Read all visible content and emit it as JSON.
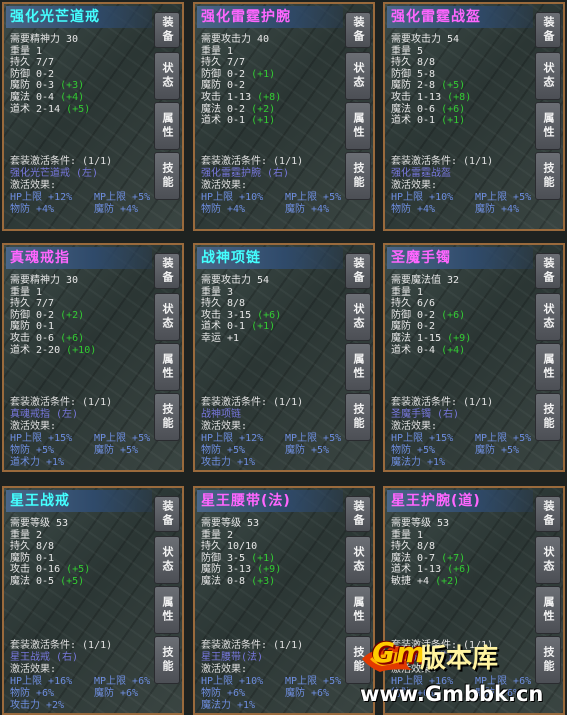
{
  "cards": [
    {
      "title": "强化光芒道戒",
      "title_color": "#44ffff",
      "stats": [
        {
          "text": "需要精神力 30",
          "bonus": ""
        },
        {
          "text": "重量 1",
          "bonus": ""
        },
        {
          "text": "持久 7/7",
          "bonus": ""
        },
        {
          "text": "防御 0-2",
          "bonus": ""
        },
        {
          "text": "魔防 0-3",
          "bonus": "(+3)"
        },
        {
          "text": "魔法 0-4",
          "bonus": "(+4)"
        },
        {
          "text": "道术 2-14",
          "bonus": "(+5)"
        }
      ],
      "set_label": "套装激活条件: (1/1)",
      "set_piece": "强化光芒道戒 (左)",
      "effect_label": "激活效果:",
      "effects": [
        "HP上限 +12%",
        "MP上限 +5%",
        "物防 +4%",
        "魔防 +4%"
      ]
    },
    {
      "title": "强化雷霆护腕",
      "title_color": "#ff66ff",
      "stats": [
        {
          "text": "需要攻击力 40",
          "bonus": ""
        },
        {
          "text": "重量 1",
          "bonus": ""
        },
        {
          "text": "持久 7/7",
          "bonus": ""
        },
        {
          "text": "防御 0-2",
          "bonus": "(+1)"
        },
        {
          "text": "魔防 0-2",
          "bonus": ""
        },
        {
          "text": "攻击 1-13",
          "bonus": "(+8)"
        },
        {
          "text": "魔法 0-2",
          "bonus": "(+2)"
        },
        {
          "text": "道术 0-1",
          "bonus": "(+1)"
        }
      ],
      "set_label": "套装激活条件: (1/1)",
      "set_piece": "强化雷霆护腕 (右)",
      "effect_label": "激活效果:",
      "effects": [
        "HP上限 +10%",
        "MP上限 +5%",
        "物防 +4%",
        "魔防 +4%"
      ]
    },
    {
      "title": "强化雷霆战盔",
      "title_color": "#ff66ff",
      "stats": [
        {
          "text": "需要攻击力 54",
          "bonus": ""
        },
        {
          "text": "重量 5",
          "bonus": ""
        },
        {
          "text": "持久 8/8",
          "bonus": ""
        },
        {
          "text": "防御 5-8",
          "bonus": ""
        },
        {
          "text": "魔防 2-8",
          "bonus": "(+5)"
        },
        {
          "text": "攻击 1-13",
          "bonus": "(+8)"
        },
        {
          "text": "魔法 0-6",
          "bonus": "(+6)"
        },
        {
          "text": "道术 0-1",
          "bonus": "(+1)"
        }
      ],
      "set_label": "套装激活条件: (1/1)",
      "set_piece": "强化雷霆战盔",
      "effect_label": "激活效果:",
      "effects": [
        "HP上限 +10%",
        "MP上限 +5%",
        "物防 +4%",
        "魔防 +4%"
      ]
    },
    {
      "title": "真魂戒指",
      "title_color": "#ff66ff",
      "stats": [
        {
          "text": "需要精神力 30",
          "bonus": ""
        },
        {
          "text": "重量 1",
          "bonus": ""
        },
        {
          "text": "持久 7/7",
          "bonus": ""
        },
        {
          "text": "防御 0-2",
          "bonus": "(+2)"
        },
        {
          "text": "魔防 0-1",
          "bonus": ""
        },
        {
          "text": "攻击 0-6",
          "bonus": "(+6)"
        },
        {
          "text": "道术 2-20",
          "bonus": "(+10)"
        }
      ],
      "set_label": "套装激活条件: (1/1)",
      "set_piece": "真魂戒指 (左)",
      "effect_label": "激活效果:",
      "effects": [
        "HP上限 +15%",
        "MP上限 +5%",
        "物防 +5%",
        "魔防 +5%",
        "道术力 +1%"
      ]
    },
    {
      "title": "战神项链",
      "title_color": "#44ffff",
      "stats": [
        {
          "text": "需要攻击力 54",
          "bonus": ""
        },
        {
          "text": "重量 3",
          "bonus": ""
        },
        {
          "text": "持久 8/8",
          "bonus": ""
        },
        {
          "text": "攻击 3-15",
          "bonus": "(+6)"
        },
        {
          "text": "道术 0-1",
          "bonus": "(+1)"
        },
        {
          "text": "幸运 +1",
          "bonus": ""
        }
      ],
      "set_label": "套装激活条件: (1/1)",
      "set_piece": "战神项链",
      "effect_label": "激活效果:",
      "effects": [
        "HP上限 +12%",
        "MP上限 +5%",
        "物防 +5%",
        "魔防 +5%",
        "攻击力 +1%"
      ]
    },
    {
      "title": "圣魔手镯",
      "title_color": "#ff66ff",
      "stats": [
        {
          "text": "需要魔法值 32",
          "bonus": ""
        },
        {
          "text": "重量 1",
          "bonus": ""
        },
        {
          "text": "持久 6/6",
          "bonus": ""
        },
        {
          "text": "防御 0-2",
          "bonus": "(+6)"
        },
        {
          "text": "魔防 0-2",
          "bonus": ""
        },
        {
          "text": "魔法 1-15",
          "bonus": "(+9)"
        },
        {
          "text": "道术 0-4",
          "bonus": "(+4)"
        }
      ],
      "set_label": "套装激活条件: (1/1)",
      "set_piece": "圣魔手镯 (右)",
      "effect_label": "激活效果:",
      "effects": [
        "HP上限 +15%",
        "MP上限 +5%",
        "物防 +5%",
        "魔防 +5%",
        "魔法力 +1%"
      ]
    },
    {
      "title": "星王战戒",
      "title_color": "#44ffff",
      "stats": [
        {
          "text": "需要等级 53",
          "bonus": ""
        },
        {
          "text": "重量 2",
          "bonus": ""
        },
        {
          "text": "持久 8/8",
          "bonus": ""
        },
        {
          "text": "魔防 0-1",
          "bonus": ""
        },
        {
          "text": "攻击 0-16",
          "bonus": "(+5)"
        },
        {
          "text": "魔法 0-5",
          "bonus": "(+5)"
        }
      ],
      "set_label": "套装激活条件: (1/1)",
      "set_piece": "星王战戒 (右)",
      "effect_label": "激活效果:",
      "effects": [
        "HP上限 +16%",
        "MP上限 +6%",
        "物防 +6%",
        "魔防 +6%",
        "攻击力 +2%"
      ]
    },
    {
      "title": "星王腰带(法)",
      "title_color": "#ff66ff",
      "stats": [
        {
          "text": "需要等级 53",
          "bonus": ""
        },
        {
          "text": "重量 2",
          "bonus": ""
        },
        {
          "text": "持久 10/10",
          "bonus": ""
        },
        {
          "text": "防御 3-5",
          "bonus": "(+1)"
        },
        {
          "text": "魔防 3-13",
          "bonus": "(+9)"
        },
        {
          "text": "魔法 0-8",
          "bonus": "(+3)"
        }
      ],
      "set_label": "套装激活条件: (1/1)",
      "set_piece": "星王腰带(法)",
      "effect_label": "激活效果:",
      "effects": [
        "HP上限 +10%",
        "MP上限 +5%",
        "物防 +6%",
        "魔防 +6%",
        "魔法力 +1%"
      ]
    },
    {
      "title": "星王护腕(道)",
      "title_color": "#ff66ff",
      "stats": [
        {
          "text": "需要等级 53",
          "bonus": ""
        },
        {
          "text": "重量 1",
          "bonus": ""
        },
        {
          "text": "持久 8/8",
          "bonus": ""
        },
        {
          "text": "魔法 0-7",
          "bonus": "(+7)"
        },
        {
          "text": "道术 1-13",
          "bonus": "(+6)"
        },
        {
          "text": "敏捷 +4",
          "bonus": "(+2)"
        }
      ],
      "set_label": "套装激活条件: (1/1)",
      "set_piece": "星王护腕(道)",
      "effect_label": "激活效果:",
      "effects": [
        "HP上限 +16%",
        "MP上限 +6%",
        "物防 +6%",
        "魔防 +6%"
      ]
    }
  ],
  "tabs": [
    "装备",
    "状态",
    "属性",
    "技能"
  ],
  "watermark": {
    "logo": "Gm",
    "name": "版本库",
    "url": "www.Gmbbk.cn"
  }
}
